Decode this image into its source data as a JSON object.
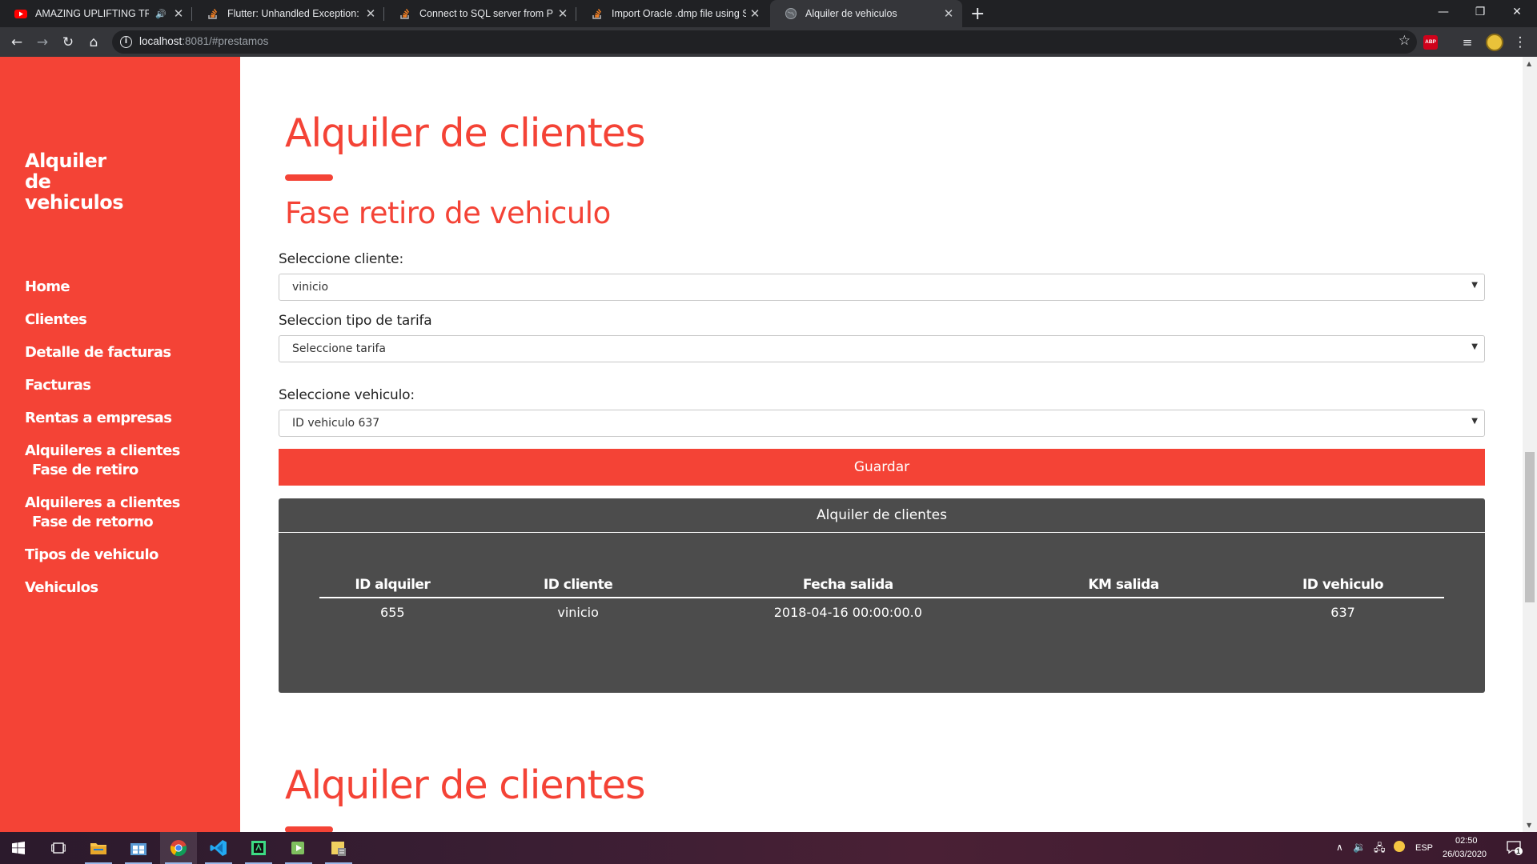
{
  "browser": {
    "tabs": [
      {
        "title": "AMAZING UPLIFTING TRANC",
        "favicon": "youtube-icon",
        "audio": true,
        "active": false
      },
      {
        "title": "Flutter: Unhandled Exception: Se",
        "favicon": "stackoverflow-icon",
        "active": false
      },
      {
        "title": "Connect to SQL server from PHP",
        "favicon": "stackoverflow-icon",
        "active": false
      },
      {
        "title": "Import Oracle .dmp file using SQ",
        "favicon": "stackoverflow-icon",
        "active": false
      },
      {
        "title": "Alquiler de vehiculos",
        "favicon": "globe-icon",
        "active": true
      }
    ],
    "address": {
      "host": "localhost",
      "rest": ":8081/#prestamos"
    },
    "extension_label": "ABP"
  },
  "sidebar": {
    "brand_lines": [
      "Alquiler",
      "de",
      "vehiculos"
    ],
    "nav": [
      {
        "label": "Home"
      },
      {
        "label": "Clientes"
      },
      {
        "label": "Detalle de facturas"
      },
      {
        "label": "Facturas"
      },
      {
        "label": "Rentas a empresas"
      },
      {
        "label": "Alquileres a clientes",
        "sub": "Fase de retiro"
      },
      {
        "label": "Alquileres a clientes",
        "sub": "Fase de retorno"
      },
      {
        "label": "Tipos de vehiculo"
      },
      {
        "label": "Vehiculos"
      }
    ]
  },
  "main": {
    "title": "Alquiler de clientes",
    "subtitle": "Fase retiro de vehiculo",
    "form": {
      "cliente_label": "Seleccione cliente:",
      "cliente_value": "vinicio",
      "tarifa_label": "Seleccion tipo de tarifa",
      "tarifa_value": "Seleccione tarifa",
      "vehiculo_label": "Seleccione vehiculo:",
      "vehiculo_value": "ID vehiculo 637",
      "save_label": "Guardar"
    },
    "panel": {
      "title": "Alquiler de clientes",
      "columns": [
        "ID alquiler",
        "ID cliente",
        "Fecha salida",
        "KM salida",
        "ID vehiculo"
      ],
      "rows": [
        [
          "655",
          "vinicio",
          "2018-04-16 00:00:00.0",
          "",
          "637"
        ]
      ]
    },
    "second_title": "Alquiler de clientes"
  },
  "taskbar": {
    "apps": [
      "start-icon",
      "task-view-icon",
      "file-explorer-icon",
      "store-icon",
      "chrome-icon",
      "vscode-icon",
      "android-studio-icon",
      "media-icon",
      "sql-developer-icon"
    ],
    "language": "ESP",
    "time": "02:50",
    "date": "26/03/2020",
    "notification_count": "1"
  },
  "colors": {
    "accent": "#f44336",
    "panel": "#4c4c4c",
    "chrome_dark": "#202124",
    "chrome_toolbar": "#35363a"
  }
}
